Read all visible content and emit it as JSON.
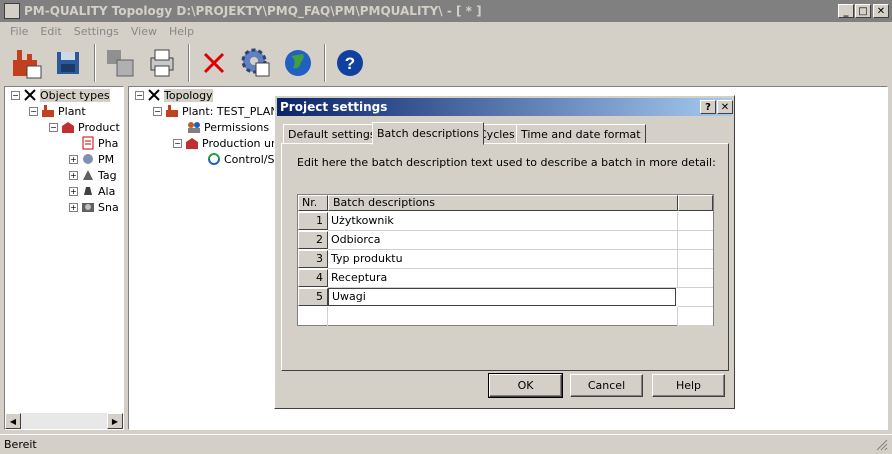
{
  "window": {
    "title": "PM-QUALITY Topology D:\\PROJEKTY\\PMQ_FAQ\\PM\\PMQUALITY\\ - [ * ]"
  },
  "menu": [
    "File",
    "Edit",
    "Settings",
    "View",
    "Help"
  ],
  "left_tree": {
    "root": "Object types",
    "plant": "Plant",
    "product": "Product",
    "children": [
      "Pha",
      "PM",
      "Tag",
      "Ala",
      "Sna"
    ]
  },
  "mid_tree": {
    "root": "Topology",
    "plant": "Plant: TEST_PLAN",
    "permissions": "Permissions",
    "production": "Production un",
    "control": "Control/S"
  },
  "dialog": {
    "title": "Project settings",
    "tabs": [
      "Default settings",
      "Batch descriptions",
      "Cycles",
      "Time and date format"
    ],
    "selected_tab": 1,
    "instruction": "Edit here the batch description text used to describe a batch in more detail:",
    "table": {
      "headers": [
        "Nr.",
        "Batch descriptions"
      ],
      "rows": [
        {
          "nr": "1",
          "desc": "Użytkownik"
        },
        {
          "nr": "2",
          "desc": "Odbiorca"
        },
        {
          "nr": "3",
          "desc": "Typ produktu"
        },
        {
          "nr": "4",
          "desc": "Receptura"
        },
        {
          "nr": "5",
          "desc": "Uwagi"
        }
      ]
    },
    "buttons": {
      "ok": "OK",
      "cancel": "Cancel",
      "help": "Help"
    },
    "help_glyph": "?",
    "close_glyph": "✕"
  },
  "status": {
    "text": "Bereit"
  },
  "colors": {
    "titlebar_inactive": "#808080",
    "dialog_title_start": "#0a246a",
    "dialog_title_end": "#a6caf0"
  }
}
